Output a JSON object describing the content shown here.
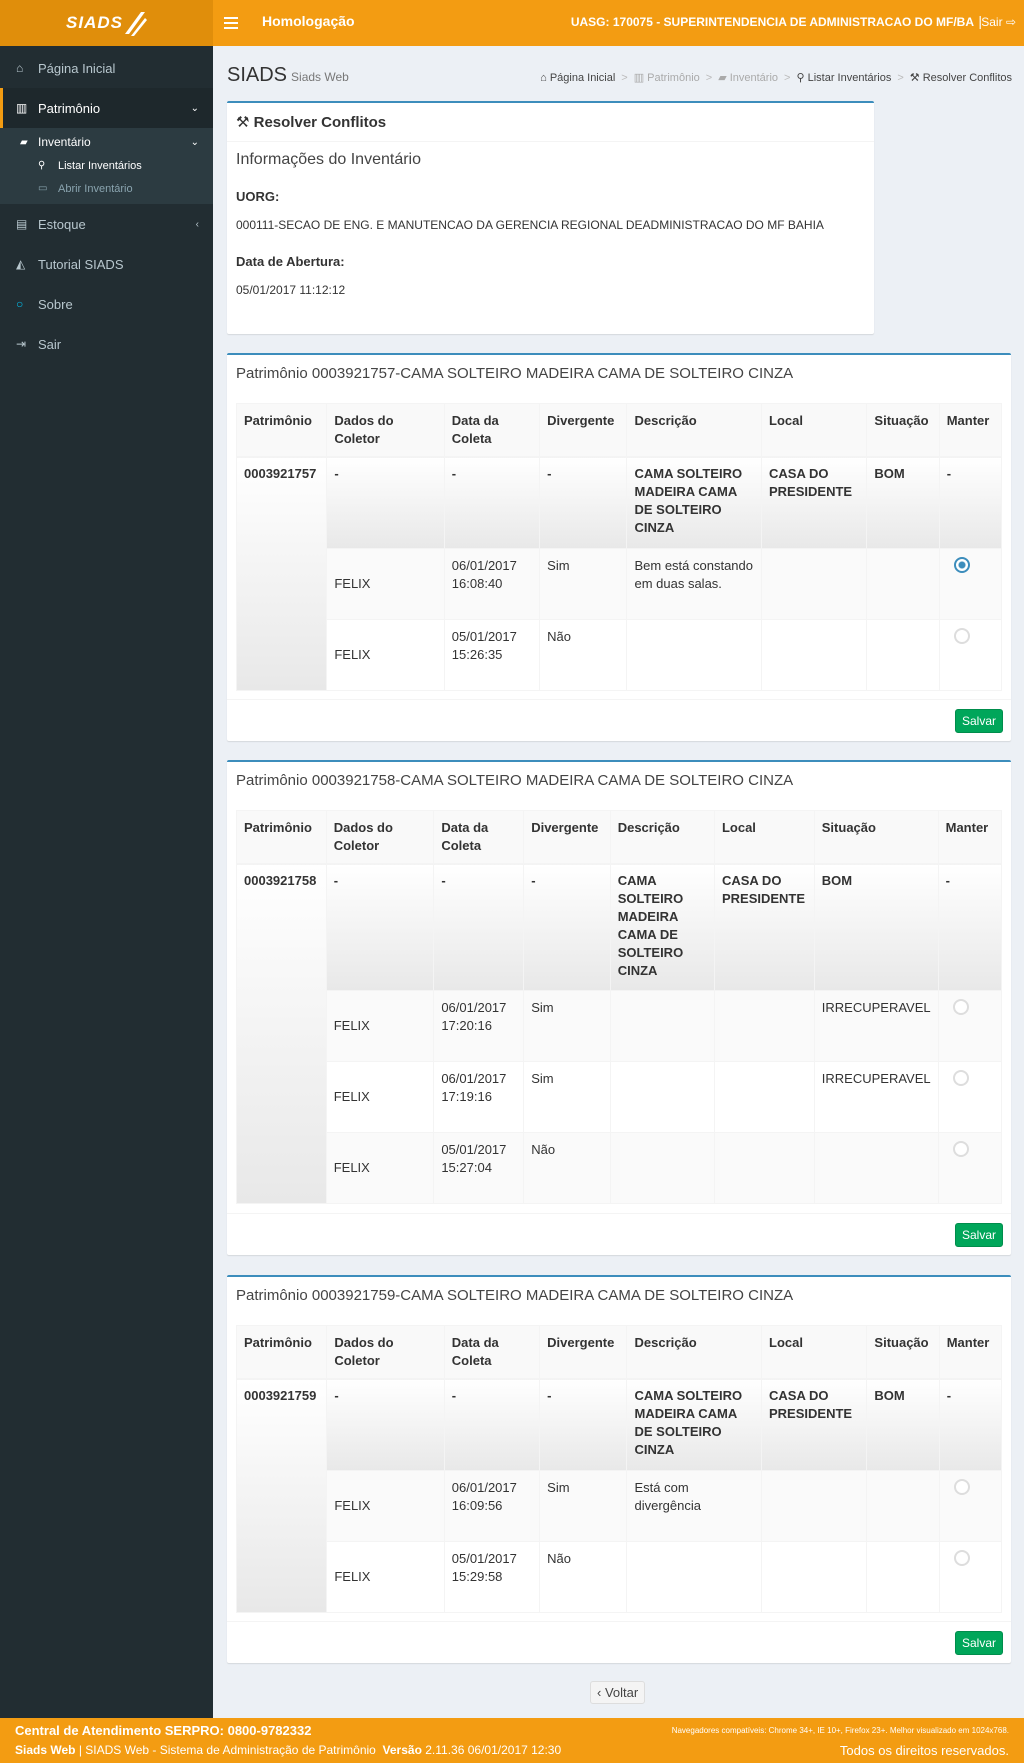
{
  "header": {
    "logo": "SIADS",
    "environment": "Homologação",
    "uasg": "UASG: 170075 - SUPERINTENDENCIA DE ADMINISTRACAO DO MF/BA",
    "separator": "|",
    "logout": "Sair"
  },
  "sidebar": {
    "home": "Página Inicial",
    "patrimonio": "Patrimônio",
    "inventario": "Inventário",
    "listar": "Listar Inventários",
    "abrir": "Abrir Inventário",
    "estoque": "Estoque",
    "tutorial": "Tutorial SIADS",
    "sobre": "Sobre",
    "sair": "Sair"
  },
  "page": {
    "title": "SIADS",
    "subtitle": "Siads Web",
    "breadcrumb": [
      "Página Inicial",
      "Patrimônio",
      "Inventário",
      "Listar Inventários",
      "Resolver Conflitos"
    ]
  },
  "info": {
    "box_title": "Resolver Conflitos",
    "section_title": "Informações do Inventário",
    "uorg_label": "UORG:",
    "uorg_value": "000111-SECAO DE ENG. E MANUTENCAO DA GERENCIA REGIONAL DEADMINISTRACAO DO MF BAHIA",
    "date_label": "Data de Abertura:",
    "date_value": "05/01/2017 11:12:12"
  },
  "columns": [
    "Patrimônio",
    "Dados do Coletor",
    "Data da Coleta",
    "Divergente",
    "Descrição",
    "Local",
    "Situação",
    "Manter"
  ],
  "save_label": "Salvar",
  "back_label": "Voltar",
  "assets": [
    {
      "title": "Patrimônio 0003921757-CAMA SOLTEIRO MADEIRA CAMA DE SOLTEIRO CINZA",
      "main": {
        "patrimonio": "0003921757",
        "coletor": "-",
        "data": "-",
        "divergente": "-",
        "descricao": "CAMA SOLTEIRO MADEIRA CAMA DE SOLTEIRO CINZA",
        "local": "CASA DO PRESIDENTE",
        "situacao": "BOM",
        "manter": "-"
      },
      "rows": [
        {
          "coletor": "FELIX",
          "data": "06/01/2017 16:08:40",
          "divergente": "Sim",
          "descricao": "Bem está constando em duas salas.",
          "local": "",
          "situacao": "",
          "selected": true
        },
        {
          "coletor": "FELIX",
          "data": "05/01/2017 15:26:35",
          "divergente": "Não",
          "descricao": "",
          "local": "",
          "situacao": "",
          "selected": false
        }
      ]
    },
    {
      "title": "Patrimônio 0003921758-CAMA SOLTEIRO MADEIRA CAMA DE SOLTEIRO CINZA",
      "main": {
        "patrimonio": "0003921758",
        "coletor": "-",
        "data": "-",
        "divergente": "-",
        "descricao": "CAMA SOLTEIRO MADEIRA CAMA DE SOLTEIRO CINZA",
        "local": "CASA DO PRESIDENTE",
        "situacao": "BOM",
        "manter": "-"
      },
      "rows": [
        {
          "coletor": "FELIX",
          "data": "06/01/2017 17:20:16",
          "divergente": "Sim",
          "descricao": "",
          "local": "",
          "situacao": "IRRECUPERAVEL",
          "selected": false
        },
        {
          "coletor": "FELIX",
          "data": "06/01/2017 17:19:16",
          "divergente": "Sim",
          "descricao": "",
          "local": "",
          "situacao": "IRRECUPERAVEL",
          "selected": false
        },
        {
          "coletor": "FELIX",
          "data": "05/01/2017 15:27:04",
          "divergente": "Não",
          "descricao": "",
          "local": "",
          "situacao": "",
          "selected": false
        }
      ]
    },
    {
      "title": "Patrimônio 0003921759-CAMA SOLTEIRO MADEIRA CAMA DE SOLTEIRO CINZA",
      "main": {
        "patrimonio": "0003921759",
        "coletor": "-",
        "data": "-",
        "divergente": "-",
        "descricao": "CAMA SOLTEIRO MADEIRA CAMA DE SOLTEIRO CINZA",
        "local": "CASA DO PRESIDENTE",
        "situacao": "BOM",
        "manter": "-"
      },
      "rows": [
        {
          "coletor": "FELIX",
          "data": "06/01/2017 16:09:56",
          "divergente": "Sim",
          "descricao": "Está com divergência",
          "local": "",
          "situacao": "",
          "selected": false
        },
        {
          "coletor": "FELIX",
          "data": "05/01/2017 15:29:58",
          "divergente": "Não",
          "descricao": "",
          "local": "",
          "situacao": "",
          "selected": false
        }
      ]
    }
  ],
  "footer": {
    "line1": "Central de Atendimento SERPRO: 0800-9782332",
    "line2_brand": "Siads Web",
    "line2_sep": "|",
    "line2_text": "SIADS Web - Sistema de Administração de Patrimônio",
    "version_label": "Versão",
    "version_value": "2.11.36 06/01/2017 12:30",
    "browsers": "Navegadores compatíveis: Chrome 34+, IE 10+, Firefox 23+. Melhor visualizado em 1024x768.",
    "rights": "Todos os direitos reservados."
  },
  "colors": {
    "header": "#f39c12",
    "sidebar": "#222d32",
    "accent": "#3c8dbc",
    "save": "#00a65a"
  }
}
